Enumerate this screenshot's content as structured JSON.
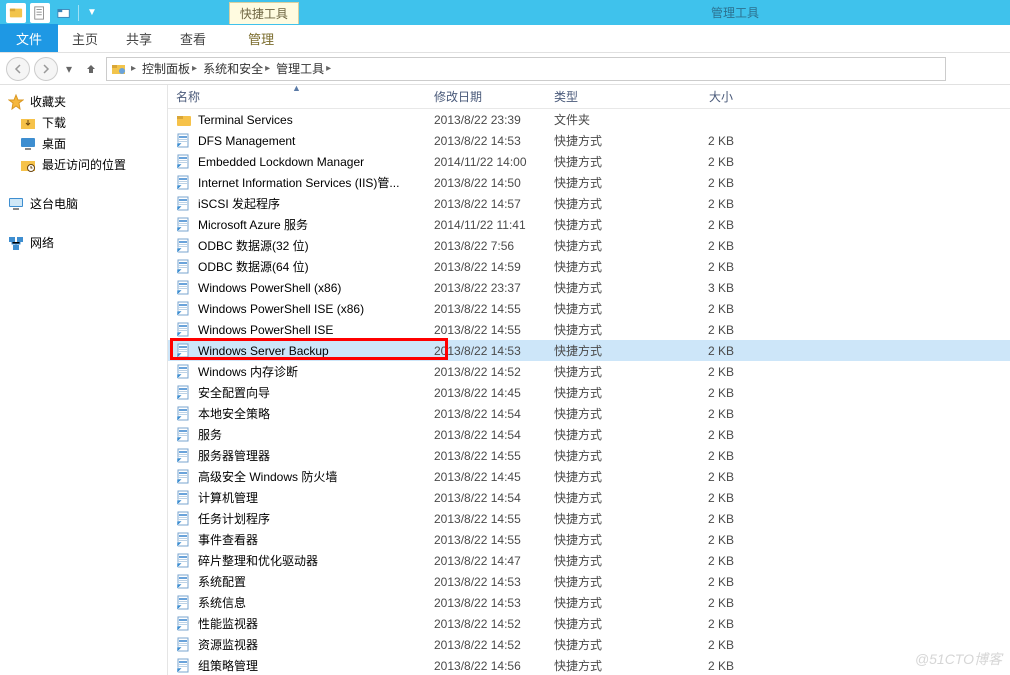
{
  "window": {
    "title_right": "管理工具",
    "tab_hint": "快捷工具"
  },
  "ribbon": {
    "file": "文件",
    "tabs": [
      "主页",
      "共享",
      "查看"
    ],
    "tool_tab": "管理"
  },
  "breadcrumbs": {
    "parts": [
      "控制面板",
      "系统和安全",
      "管理工具"
    ]
  },
  "sidebar": {
    "favorites": {
      "label": "收藏夹"
    },
    "fav_items": [
      {
        "label": "下载"
      },
      {
        "label": "桌面"
      },
      {
        "label": "最近访问的位置"
      }
    ],
    "this_pc": {
      "label": "这台电脑"
    },
    "network": {
      "label": "网络"
    }
  },
  "columns": {
    "name": "名称",
    "date": "修改日期",
    "type": "类型",
    "size": "大小"
  },
  "rows": [
    {
      "icon": "folder",
      "name": "Terminal Services",
      "date": "2013/8/22 23:39",
      "type": "文件夹",
      "size": ""
    },
    {
      "icon": "shortcut",
      "name": "DFS Management",
      "date": "2013/8/22 14:53",
      "type": "快捷方式",
      "size": "2 KB"
    },
    {
      "icon": "shortcut",
      "name": "Embedded Lockdown Manager",
      "date": "2014/11/22 14:00",
      "type": "快捷方式",
      "size": "2 KB"
    },
    {
      "icon": "shortcut",
      "name": "Internet Information Services (IIS)管...",
      "date": "2013/8/22 14:50",
      "type": "快捷方式",
      "size": "2 KB"
    },
    {
      "icon": "shortcut",
      "name": "iSCSI 发起程序",
      "date": "2013/8/22 14:57",
      "type": "快捷方式",
      "size": "2 KB"
    },
    {
      "icon": "shortcut",
      "name": "Microsoft Azure 服务",
      "date": "2014/11/22 11:41",
      "type": "快捷方式",
      "size": "2 KB"
    },
    {
      "icon": "shortcut",
      "name": "ODBC 数据源(32 位)",
      "date": "2013/8/22 7:56",
      "type": "快捷方式",
      "size": "2 KB"
    },
    {
      "icon": "shortcut",
      "name": "ODBC 数据源(64 位)",
      "date": "2013/8/22 14:59",
      "type": "快捷方式",
      "size": "2 KB"
    },
    {
      "icon": "shortcut",
      "name": "Windows PowerShell (x86)",
      "date": "2013/8/22 23:37",
      "type": "快捷方式",
      "size": "3 KB"
    },
    {
      "icon": "shortcut",
      "name": "Windows PowerShell ISE (x86)",
      "date": "2013/8/22 14:55",
      "type": "快捷方式",
      "size": "2 KB"
    },
    {
      "icon": "shortcut",
      "name": "Windows PowerShell ISE",
      "date": "2013/8/22 14:55",
      "type": "快捷方式",
      "size": "2 KB"
    },
    {
      "icon": "shortcut",
      "name": "Windows Server Backup",
      "date": "2013/8/22 14:53",
      "type": "快捷方式",
      "size": "2 KB",
      "selected": true
    },
    {
      "icon": "shortcut",
      "name": "Windows 内存诊断",
      "date": "2013/8/22 14:52",
      "type": "快捷方式",
      "size": "2 KB"
    },
    {
      "icon": "shortcut",
      "name": "安全配置向导",
      "date": "2013/8/22 14:45",
      "type": "快捷方式",
      "size": "2 KB"
    },
    {
      "icon": "shortcut",
      "name": "本地安全策略",
      "date": "2013/8/22 14:54",
      "type": "快捷方式",
      "size": "2 KB"
    },
    {
      "icon": "shortcut",
      "name": "服务",
      "date": "2013/8/22 14:54",
      "type": "快捷方式",
      "size": "2 KB"
    },
    {
      "icon": "shortcut",
      "name": "服务器管理器",
      "date": "2013/8/22 14:55",
      "type": "快捷方式",
      "size": "2 KB"
    },
    {
      "icon": "shortcut",
      "name": "高级安全 Windows 防火墙",
      "date": "2013/8/22 14:45",
      "type": "快捷方式",
      "size": "2 KB"
    },
    {
      "icon": "shortcut",
      "name": "计算机管理",
      "date": "2013/8/22 14:54",
      "type": "快捷方式",
      "size": "2 KB"
    },
    {
      "icon": "shortcut",
      "name": "任务计划程序",
      "date": "2013/8/22 14:55",
      "type": "快捷方式",
      "size": "2 KB"
    },
    {
      "icon": "shortcut",
      "name": "事件查看器",
      "date": "2013/8/22 14:55",
      "type": "快捷方式",
      "size": "2 KB"
    },
    {
      "icon": "shortcut",
      "name": "碎片整理和优化驱动器",
      "date": "2013/8/22 14:47",
      "type": "快捷方式",
      "size": "2 KB"
    },
    {
      "icon": "shortcut",
      "name": "系统配置",
      "date": "2013/8/22 14:53",
      "type": "快捷方式",
      "size": "2 KB"
    },
    {
      "icon": "shortcut",
      "name": "系统信息",
      "date": "2013/8/22 14:53",
      "type": "快捷方式",
      "size": "2 KB"
    },
    {
      "icon": "shortcut",
      "name": "性能监视器",
      "date": "2013/8/22 14:52",
      "type": "快捷方式",
      "size": "2 KB"
    },
    {
      "icon": "shortcut",
      "name": "资源监视器",
      "date": "2013/8/22 14:52",
      "type": "快捷方式",
      "size": "2 KB"
    },
    {
      "icon": "shortcut",
      "name": "组策略管理",
      "date": "2013/8/22 14:56",
      "type": "快捷方式",
      "size": "2 KB"
    }
  ],
  "highlight": {
    "row_index": 11
  },
  "watermark": "@51CTO博客"
}
